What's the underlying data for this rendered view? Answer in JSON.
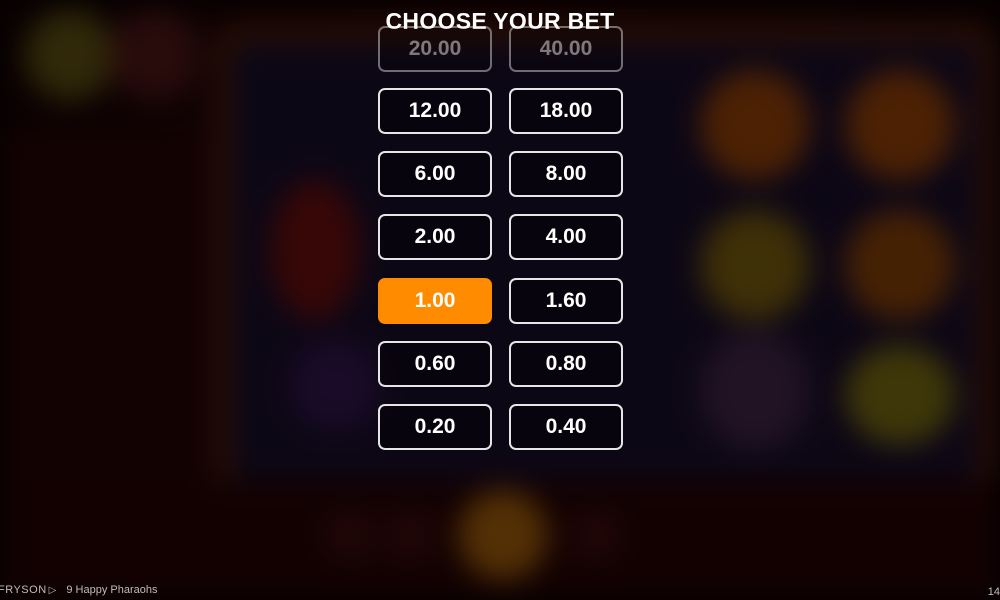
{
  "title": "CHOOSE YOUR BET",
  "bets": {
    "partial_left": "20.00",
    "partial_right": "40.00",
    "rows": [
      {
        "left": "12.00",
        "right": "18.00"
      },
      {
        "left": "6.00",
        "right": "8.00"
      },
      {
        "left": "2.00",
        "right": "4.00"
      },
      {
        "left": "1.00",
        "right": "1.60"
      },
      {
        "left": "0.60",
        "right": "0.80"
      },
      {
        "left": "0.20",
        "right": "0.40"
      }
    ],
    "selected": "1.00"
  },
  "colors": {
    "selected": "#ff8c00",
    "border": "#ffffff"
  },
  "footer": {
    "brand": "FRYSON",
    "brand_mark": "▷",
    "game_name": "9 Happy Pharaohs",
    "right_text": "14"
  }
}
